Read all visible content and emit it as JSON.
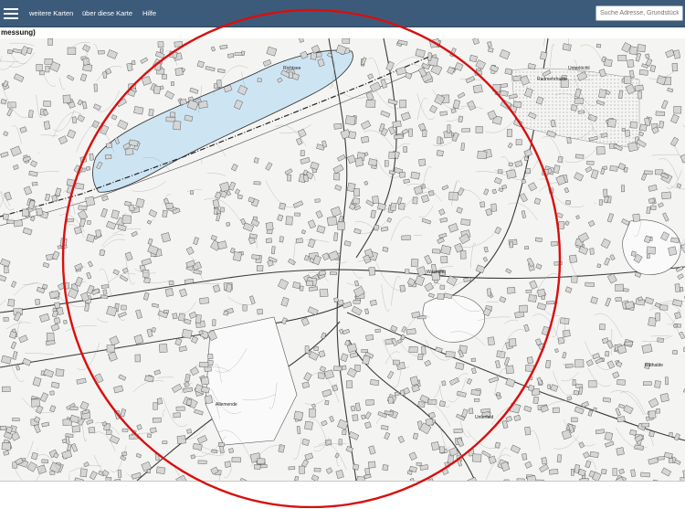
{
  "toolbar": {
    "menu_icon": "hamburger-icon",
    "nav": [
      "weitere Karten",
      "über diese Karte",
      "Hilfe"
    ]
  },
  "search": {
    "placeholder": "Suche Adresse, Grundstücknr."
  },
  "map": {
    "subtitle": "messung)",
    "labels": {
      "lake": "Richtsee",
      "north_east": "Unterlöchli",
      "north": "Radmehrhalde",
      "center": "Wasmetti",
      "south_west": "Allemende",
      "east": "Rüthalde",
      "south": "Unterfeld"
    },
    "colors": {
      "lake": "#cde5f3",
      "highlight_circle": "#d80f0f",
      "header": "#3c5b7a"
    }
  }
}
